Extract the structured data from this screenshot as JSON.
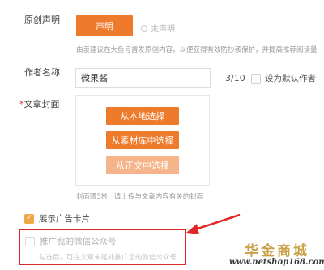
{
  "original_statement": {
    "label": "原创声明",
    "button_label": "声明",
    "radio_label": "未声明",
    "hint": "由衷建议在大鱼号首发原创内容，以便获得有效防抄袭保护，并提高推荐阅读量"
  },
  "author": {
    "label": "作者名称",
    "value": "微果酱",
    "counter": "3/10",
    "default_label": "设为默认作者"
  },
  "cover": {
    "label": "文章封面",
    "required_mark": "*",
    "buttons": [
      "从本地选择",
      "从素材库中选择",
      "从正文中选择"
    ],
    "hint": "封面限5M，请上传与文章内容有关的封面"
  },
  "ad_card": {
    "label": "展示广告卡片",
    "checked": true
  },
  "promote": {
    "label": "推广我的微信公众号",
    "hint": "勾选后，可在文章末尾处推广您的微信公众号",
    "checked": false
  },
  "watermark": {
    "title": "华金商城",
    "url": "www.netshop168.com"
  },
  "colors": {
    "accent": "#ee7a2c",
    "highlight": "#e02828",
    "check": "#f0a94a"
  },
  "icons": {
    "checkmark": "✓"
  }
}
